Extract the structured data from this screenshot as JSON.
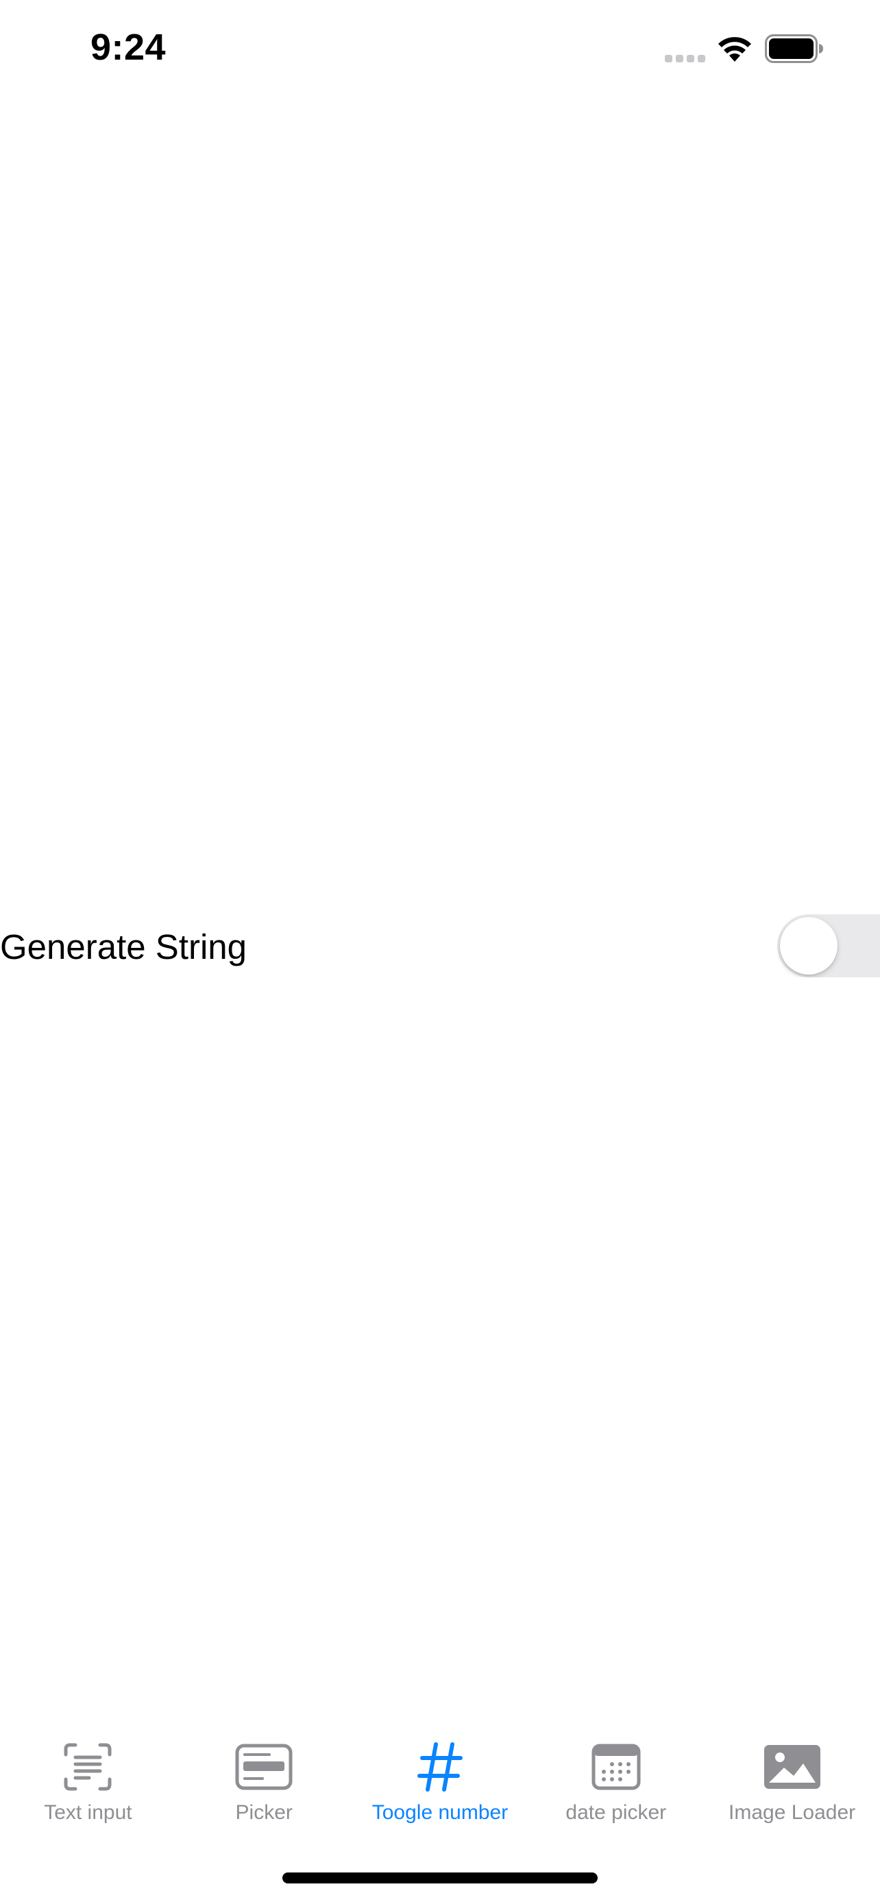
{
  "status_bar": {
    "time": "9:24"
  },
  "toggle_row": {
    "label": "Generate String",
    "on": false
  },
  "tab_bar": {
    "active_color": "#0a84ff",
    "inactive_color": "#8e8e93",
    "tabs": [
      {
        "label": "Text input",
        "icon": "text-scan-icon",
        "active": false
      },
      {
        "label": "Picker",
        "icon": "picker-icon",
        "active": false
      },
      {
        "label": "Toogle number",
        "icon": "number-sign-icon",
        "active": true
      },
      {
        "label": "date picker",
        "icon": "calendar-icon",
        "active": false
      },
      {
        "label": "Image Loader",
        "icon": "photo-icon",
        "active": false
      }
    ]
  }
}
